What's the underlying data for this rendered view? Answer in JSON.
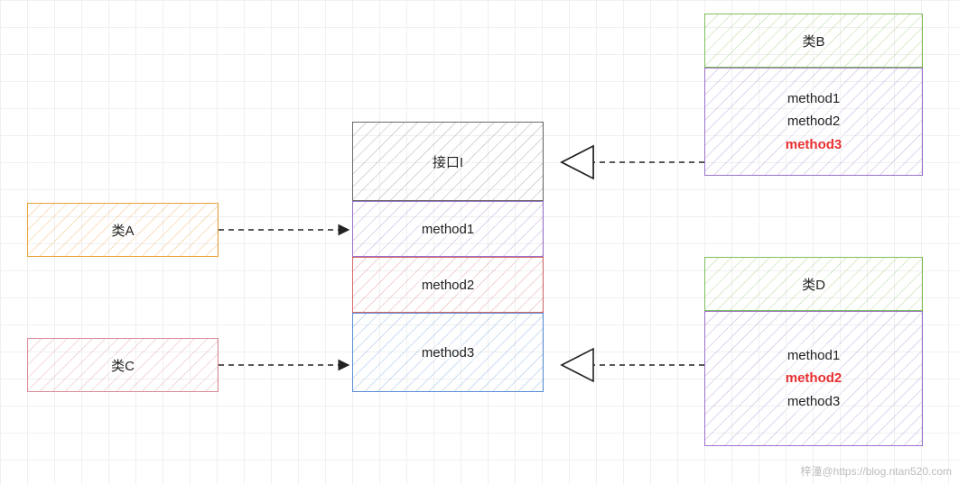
{
  "colors": {
    "orange": "#e8a13a",
    "pink": "#d98b99",
    "green": "#7fbf5a",
    "purple": "#9b72c9",
    "grey": "#6b6b6b",
    "red": "#d56a6a",
    "blue": "#5a8fd6",
    "highlight": "#e73131"
  },
  "classA": {
    "label": "类A"
  },
  "classC": {
    "label": "类C"
  },
  "interfaceI": {
    "title": "接口I",
    "m1": "method1",
    "m2": "method2",
    "m3": "method3"
  },
  "classB": {
    "title": "类B",
    "m1": "method1",
    "m2": "method2",
    "m3": "method3"
  },
  "classD": {
    "title": "类D",
    "m1": "method1",
    "m2": "method2",
    "m3": "method3"
  },
  "watermark": "梓潼@https://blog.ntan520.com"
}
